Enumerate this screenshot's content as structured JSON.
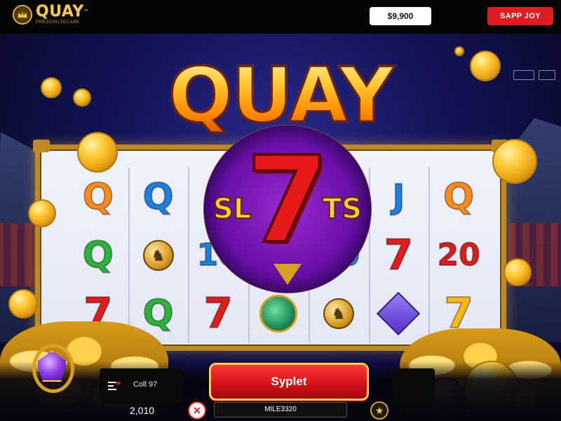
{
  "header": {
    "logo_title": "QUAY",
    "logo_tm": "™",
    "logo_subtitle": "PREDCHILTECARE",
    "balance": "$9,900",
    "cta_label": "SAPP JOY"
  },
  "game": {
    "headline": "QUAY",
    "emblem_number": "7",
    "emblem_left": "SL",
    "emblem_right": "TS",
    "reels": [
      [
        {
          "type": "text",
          "value": "Q",
          "style": "q-orange"
        },
        {
          "type": "text",
          "value": "Q",
          "style": "q-green"
        },
        {
          "type": "text",
          "value": "7",
          "style": "7"
        }
      ],
      [
        {
          "type": "text",
          "value": "Q",
          "style": "q-blue"
        },
        {
          "type": "icon",
          "icon": "coin-emblem"
        },
        {
          "type": "text",
          "value": "Q",
          "style": "q-green"
        }
      ],
      [
        {
          "type": "blank"
        },
        {
          "type": "text",
          "value": "10",
          "style": "10"
        },
        {
          "type": "text",
          "value": "7",
          "style": "7"
        }
      ],
      [
        {
          "type": "blank"
        },
        {
          "type": "blank"
        },
        {
          "type": "icon",
          "icon": "clover-symbol"
        }
      ],
      [
        {
          "type": "blank"
        },
        {
          "type": "text",
          "value": "10",
          "style": "10"
        },
        {
          "type": "icon",
          "icon": "coin-emblem"
        }
      ],
      [
        {
          "type": "text",
          "value": "J",
          "style": "j"
        },
        {
          "type": "text",
          "value": "7",
          "style": "7"
        },
        {
          "type": "icon",
          "icon": "gem-symbol"
        }
      ],
      [
        {
          "type": "text",
          "value": "Q",
          "style": "q-orange"
        },
        {
          "type": "text",
          "value": "20",
          "style": "20"
        },
        {
          "type": "text",
          "value": "7",
          "style": "7-gold"
        }
      ]
    ]
  },
  "controls": {
    "bet_icon": "menu-icon",
    "bet_label": "Coll 97",
    "credits": "2,010",
    "spin_label": "Syplet",
    "win_text": "MILE3320",
    "close_glyph": "✕",
    "star_glyph": "★"
  },
  "colors": {
    "brand_gold": "#f1c94e",
    "cta_red": "#e01b22",
    "background_blue": "#14145a"
  }
}
